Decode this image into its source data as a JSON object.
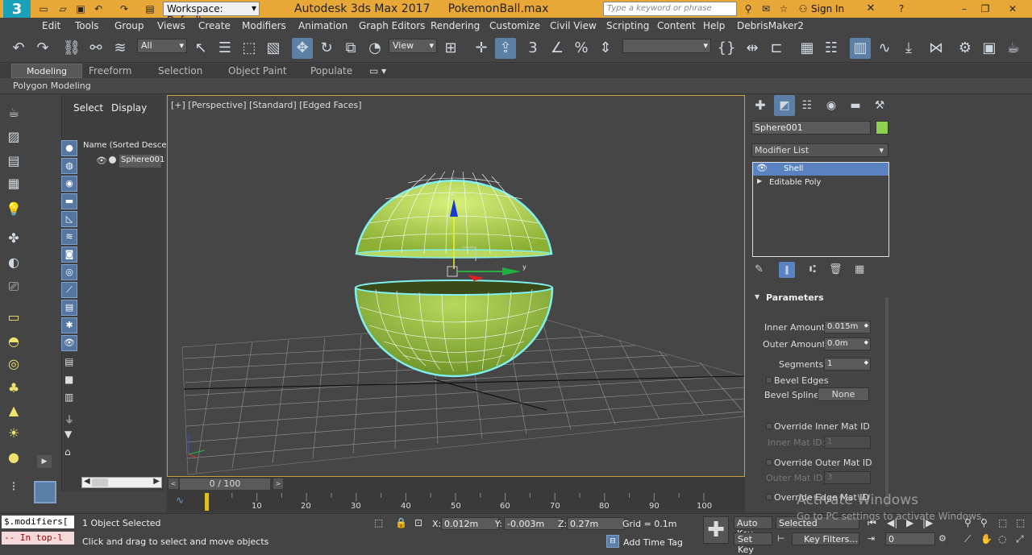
{
  "titlebar": {
    "app_icon": "3ds-max-logo",
    "workspace": "Workspace: Default",
    "title": "Autodesk 3ds Max 2017     PokemonBall.max",
    "search_placeholder": "Type a keyword or phrase",
    "sign_in": "Sign In"
  },
  "menu": [
    "Edit",
    "Tools",
    "Group",
    "Views",
    "Create",
    "Modifiers",
    "Animation",
    "Graph Editors",
    "Rendering",
    "Customize",
    "Civil View",
    "Scripting",
    "Content",
    "Help",
    "DebrisMaker2"
  ],
  "toolbar": {
    "selection_filter": "All",
    "ref_coord": "View",
    "named_set": ""
  },
  "ribbon": {
    "tabs": [
      "Modeling",
      "Freeform",
      "Selection",
      "Object Paint",
      "Populate"
    ],
    "row_label": "Polygon Modeling"
  },
  "scene_explorer": {
    "tabs": [
      "Select",
      "Display"
    ],
    "column_header": "Name (Sorted Descen",
    "items": [
      "Sphere001"
    ]
  },
  "viewport": {
    "label": "[+] [Perspective] [Standard] [Edged Faces]"
  },
  "command_panel": {
    "object_name": "Sphere001",
    "object_color": "#8fd050",
    "modifier_list": "Modifier List",
    "stack": [
      "Shell",
      "Editable Poly"
    ],
    "rollout_title": "Parameters",
    "params": {
      "inner_amount_label": "Inner Amount:",
      "inner_amount": "0.015m",
      "outer_amount_label": "Outer Amount:",
      "outer_amount": "0.0m",
      "segments_label": "Segments:",
      "segments": "1",
      "bevel_edges": "Bevel Edges",
      "bevel_spline_label": "Bevel Spline:",
      "bevel_spline": "None",
      "override_inner": "Override Inner Mat ID",
      "inner_mat_label": "Inner Mat ID:",
      "inner_mat": "1",
      "override_outer": "Override Outer Mat ID",
      "outer_mat_label": "Outer Mat ID:",
      "outer_mat": "3",
      "override_edge": "Override Edge Mat ID"
    }
  },
  "timeline": {
    "frame": "0 / 100",
    "ticks": [
      "10",
      "20",
      "30",
      "40",
      "50",
      "60",
      "70",
      "80",
      "90",
      "100"
    ]
  },
  "status": {
    "maxscript_input": "$.modifiers[",
    "maxscript_output": "-- In top-l",
    "selected": "1 Object Selected",
    "prompt": "Click and drag to select and move objects",
    "x_label": "X:",
    "x": "0.012m",
    "y_label": "Y:",
    "y": "-0.003m",
    "z_label": "Z:",
    "z": "0.27m",
    "grid": "Grid = 0.1m",
    "add_time_tag": "Add Time Tag",
    "auto_key": "Auto Key",
    "set_key": "Set Key",
    "key_mode": "Selected",
    "key_filters": "Key Filters...",
    "current_frame": "0"
  },
  "watermark": {
    "line1": "Activate Windows",
    "line2": "Go to PC settings to activate Windows."
  }
}
